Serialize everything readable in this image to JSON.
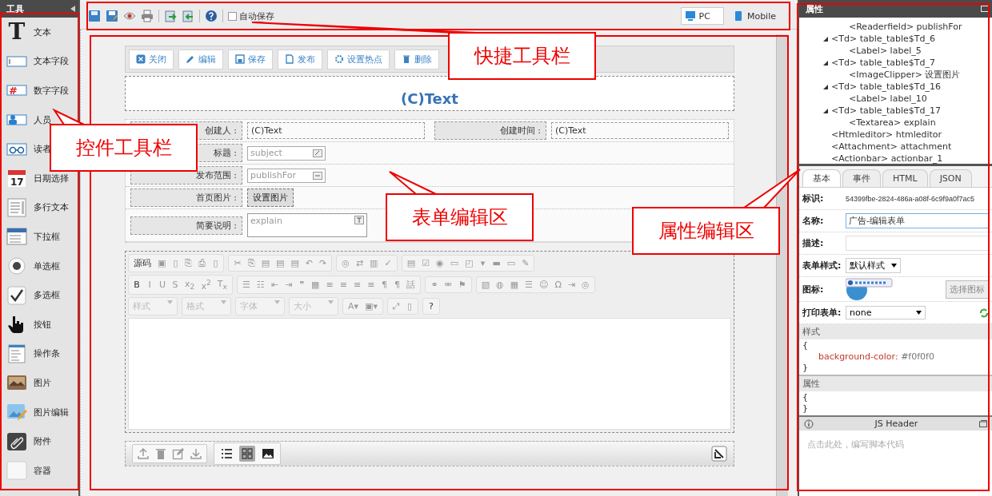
{
  "tools": {
    "title": "工具",
    "items": [
      {
        "kind": "text",
        "glyph": "T",
        "label": "文本"
      },
      {
        "kind": "textfield",
        "label": "文本字段"
      },
      {
        "kind": "number",
        "glyph": "#",
        "label": "数字字段"
      },
      {
        "kind": "person",
        "label": "人员"
      },
      {
        "kind": "reader",
        "label": "读者"
      },
      {
        "kind": "date",
        "glyph": "17",
        "label": "日期选择"
      },
      {
        "kind": "multiline",
        "label": "多行文本"
      },
      {
        "kind": "dropdown",
        "label": "下拉框"
      },
      {
        "kind": "radio",
        "label": "单选框"
      },
      {
        "kind": "checkbox",
        "label": "多选框"
      },
      {
        "kind": "button",
        "label": "按钮"
      },
      {
        "kind": "actionbar",
        "label": "操作条"
      },
      {
        "kind": "image",
        "label": "图片"
      },
      {
        "kind": "imageeditor",
        "label": "图片编辑"
      },
      {
        "kind": "attachment",
        "label": "附件"
      },
      {
        "kind": "container",
        "label": "容器"
      }
    ]
  },
  "toolbar": {
    "icons": [
      {
        "kind": "save"
      },
      {
        "kind": "saveas"
      },
      {
        "kind": "preview"
      },
      {
        "kind": "print"
      },
      {
        "kind": "import"
      },
      {
        "kind": "export"
      },
      {
        "kind": "help"
      }
    ],
    "autosave": {
      "label": "自动保存",
      "checked": false
    },
    "views": [
      {
        "kind": "pc",
        "label": "PC",
        "selected": true
      },
      {
        "kind": "mobile",
        "label": "Mobile",
        "selected": false
      }
    ]
  },
  "form": {
    "actions": [
      {
        "kind": "close",
        "label": "关闭"
      },
      {
        "kind": "edit",
        "label": "编辑"
      },
      {
        "kind": "save",
        "label": "保存"
      },
      {
        "kind": "publish",
        "label": "发布"
      },
      {
        "kind": "hotspot",
        "label": "设置热点"
      },
      {
        "kind": "delete",
        "label": "删除"
      }
    ],
    "title": "(C)Text",
    "rows": [
      {
        "cells": [
          {
            "label": "创建人 :",
            "kind": "text",
            "value": "(C)Text"
          },
          {
            "label": "创建时间 :",
            "kind": "text",
            "value": "(C)Text"
          }
        ]
      },
      {
        "cells": [
          {
            "label": "标题 :",
            "kind": "input",
            "placeholder": "subject"
          }
        ]
      },
      {
        "cells": [
          {
            "label": "发布范围 :",
            "kind": "picker",
            "placeholder": "publishFor"
          }
        ]
      },
      {
        "cells": [
          {
            "label": "首页图片 :",
            "kind": "button",
            "value": "设置图片"
          }
        ]
      },
      {
        "cells": [
          {
            "label": "简要说明 :",
            "kind": "textarea",
            "placeholder": "explain"
          }
        ]
      }
    ],
    "editor": {
      "toolbars": [
        {
          "groups": [
            {
              "items": [
                "源码",
                "▣",
                "▯",
                "⎘",
                "⎙",
                "▯"
              ]
            },
            {
              "items": [
                "✂",
                "⎘",
                "▤",
                "▤",
                "▤",
                "↶",
                "↷"
              ]
            },
            {
              "items": [
                "◎",
                "⇄",
                "▥",
                "✓"
              ]
            },
            {
              "items": [
                "▤",
                "☑",
                "◉",
                "▭",
                "◰",
                "▾",
                "▬",
                "▭",
                "✎"
              ]
            }
          ]
        },
        {
          "groups": [
            {
              "items": [
                "B",
                "I",
                "U",
                "S",
                "x$_{2}$",
                "x$^{2}$",
                "T$_{x}$"
              ]
            },
            {
              "items": [
                "☰",
                "☷",
                "⇤",
                "⇥",
                "❞",
                "▦",
                "≡",
                "≡",
                "≡",
                "≡",
                "¶",
                "¶",
                "話"
              ]
            },
            {
              "items": [
                "⚭",
                "⚮",
                "⚑"
              ]
            },
            {
              "items": [
                "▧",
                "◍",
                "▦",
                "☰",
                "☺",
                "Ω",
                "⇥",
                "◎"
              ]
            }
          ]
        }
      ],
      "selects": [
        "样式",
        "格式",
        "字体",
        "大小"
      ],
      "tail": [
        {
          "items": [
            "A▾",
            "▣▾"
          ]
        },
        {
          "items": [
            "⤢",
            "▯"
          ]
        },
        {
          "items": [
            "?"
          ]
        }
      ]
    },
    "attachments": {
      "tools": [
        {
          "kind": "upload"
        },
        {
          "kind": "delete"
        },
        {
          "kind": "edit"
        },
        {
          "kind": "download"
        }
      ],
      "views": [
        {
          "kind": "list",
          "selected": false
        },
        {
          "kind": "grid",
          "selected": true
        },
        {
          "kind": "image",
          "selected": false
        }
      ]
    }
  },
  "properties": {
    "title": "属性",
    "tree": {
      "continued": [
        {
          "label": "<Readerfield> publishFor"
        }
      ],
      "items": [
        {
          "label": "<Td> table_table$Td_6",
          "expanded": true,
          "children": [
            {
              "label": "<Label> label_5"
            }
          ]
        },
        {
          "label": "<Td> table_table$Td_7",
          "expanded": true,
          "children": [
            {
              "label": "<ImageClipper> 设置图片"
            }
          ]
        },
        {
          "label": "<Td> table_table$Td_16",
          "expanded": true,
          "children": [
            {
              "label": "<Label> label_10"
            }
          ]
        },
        {
          "label": "<Td> table_table$Td_17",
          "expanded": true,
          "children": [
            {
              "label": "<Textarea> explain"
            }
          ]
        },
        {
          "label": "<Htmleditor> htmleditor"
        },
        {
          "label": "<Attachment> attachment"
        },
        {
          "label": "<Actionbar> actionbar_1"
        }
      ]
    },
    "tabs": [
      {
        "label": "基本",
        "selected": true
      },
      {
        "label": "事件",
        "selected": false
      },
      {
        "label": "HTML",
        "selected": false
      },
      {
        "label": "JSON",
        "selected": false
      }
    ],
    "fields": [
      {
        "label": "标识:",
        "kind": "text",
        "value": "54399fbe-2824-486a-a08f-6c9f9a0f7ac5"
      },
      {
        "label": "名称:",
        "kind": "input",
        "value": "广告-编辑表单"
      },
      {
        "label": "描述:",
        "kind": "input"
      },
      {
        "label": "表单样式:",
        "kind": "select",
        "value": "默认样式"
      },
      {
        "label": "图标:",
        "kind": "icon",
        "button": "选择图标"
      },
      {
        "label": "打印表单:",
        "kind": "select-refresh",
        "value": "none"
      }
    ],
    "style": {
      "title": "样式",
      "open": "{",
      "property": "background-color:",
      "value": "#f0f0f0",
      "close": "}"
    },
    "attributes": {
      "title": "属性",
      "open": "{",
      "close": "}"
    },
    "js": {
      "title": "JS Header",
      "placeholder": "点击此处，编写脚本代码"
    }
  },
  "callouts": [
    {
      "kind": "toolbar",
      "label": "快捷工具栏"
    },
    {
      "kind": "tools",
      "label": "控件工具栏"
    },
    {
      "kind": "form",
      "label": "表单编辑区"
    },
    {
      "kind": "props",
      "label": "属性编辑区"
    }
  ]
}
